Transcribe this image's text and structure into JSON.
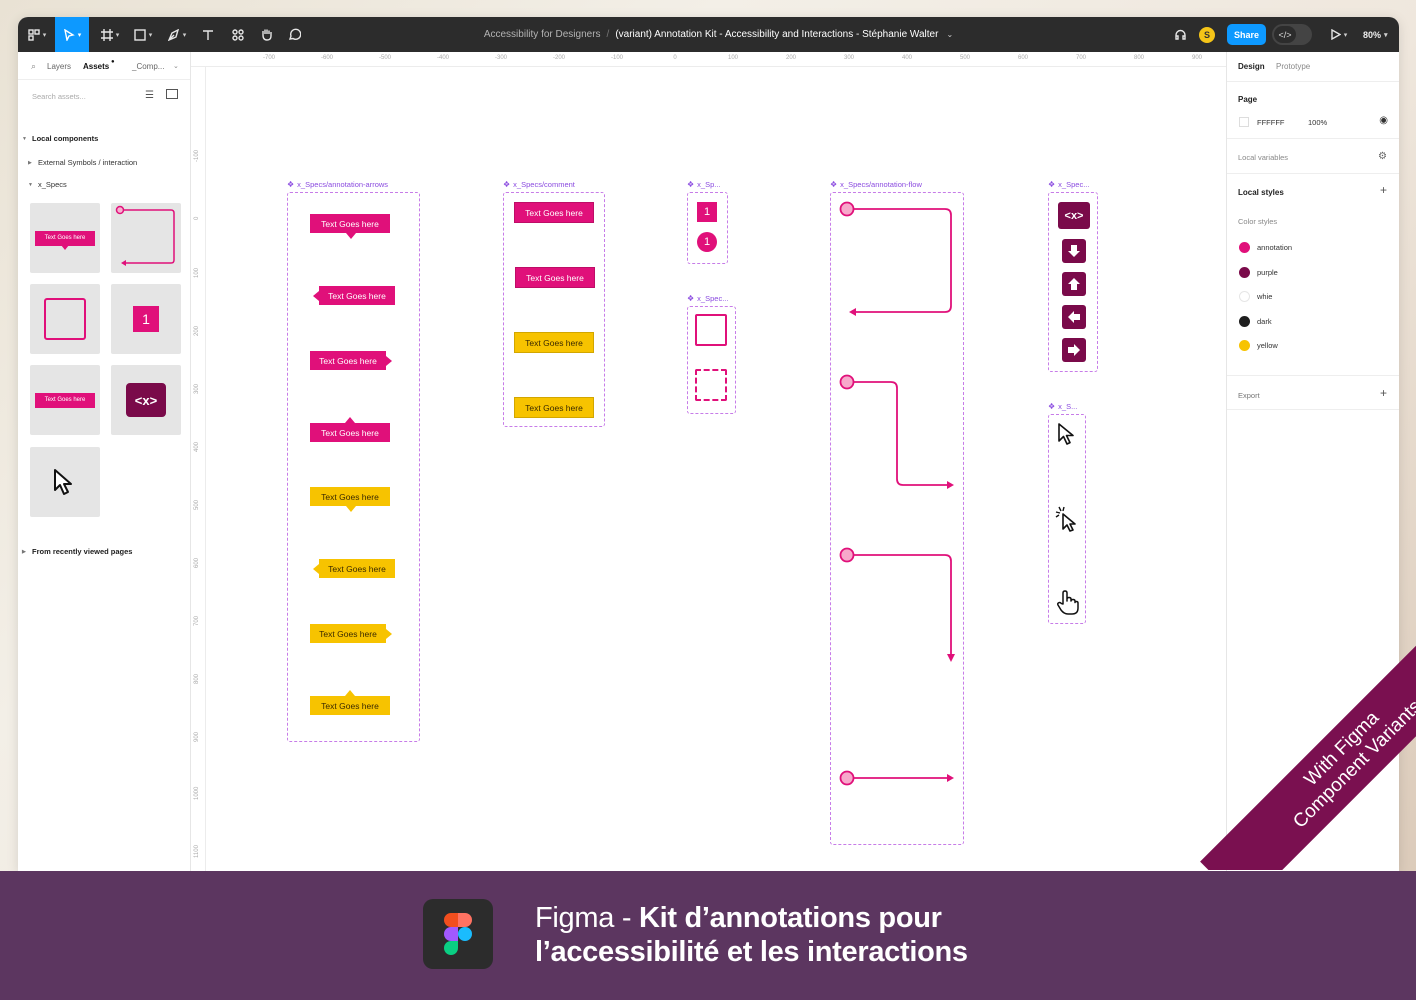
{
  "toolbar": {
    "project": "Accessibility for Designers",
    "separator": "/",
    "file": "(variant) Annotation Kit - Accessibility and Interactions - Stéphanie Walter",
    "avatar": "S",
    "share": "Share",
    "zoom": "80%",
    "icons": [
      "figma-menu-icon",
      "move-tool-icon",
      "frame-tool-icon",
      "shape-tool-icon",
      "pen-tool-icon",
      "text-tool-icon",
      "components-icon",
      "hand-tool-icon",
      "comment-icon",
      "headphones-icon",
      "dev-mode-icon",
      "present-icon"
    ]
  },
  "left_panel": {
    "tabs": [
      "Layers",
      "Assets",
      "_Comp..."
    ],
    "search_placeholder": "Search assets...",
    "local_components": "Local components",
    "external": "External Symbols / interaction",
    "specs": "x_Specs",
    "thumb_text_1": "Text Goes here",
    "thumb_text_2": "Text Goes here",
    "thumb_num": "1",
    "thumb_code": "<x>",
    "recent": "From recently viewed pages"
  },
  "ruler": {
    "top": [
      "-700",
      "-600",
      "-500",
      "-400",
      "-300",
      "-200",
      "-100",
      "0",
      "100",
      "200",
      "300",
      "400",
      "500",
      "600",
      "700",
      "800",
      "900"
    ],
    "left": [
      "-100",
      "0",
      "100",
      "200",
      "300",
      "400",
      "500",
      "600",
      "700",
      "800",
      "900",
      "1000",
      "1100"
    ]
  },
  "canvas": {
    "frames": {
      "arrows": "x_Specs/annotation-arrows",
      "comment": "x_Specs/comment",
      "sp": "x_Sp...",
      "spec_sq": "x_Spec...",
      "flow": "x_Specs/annotation-flow",
      "spec_btns": "x_Spec...",
      "s_cursor": "x_S..."
    },
    "tag_text": "Text Goes here",
    "number": "1",
    "code": "<x>"
  },
  "right_panel": {
    "tabs": [
      "Design",
      "Prototype"
    ],
    "page_label": "Page",
    "page_color": "FFFFFF",
    "page_opacity": "100%",
    "local_variables": "Local variables",
    "local_styles": "Local styles",
    "color_styles": "Color styles",
    "styles": [
      {
        "name": "annotation",
        "color": "#e0107a"
      },
      {
        "name": "purple",
        "color": "#7a0a4a"
      },
      {
        "name": "whie",
        "color": "#ffffff"
      },
      {
        "name": "dark",
        "color": "#1e1e1e"
      },
      {
        "name": "yellow",
        "color": "#f7c300"
      }
    ],
    "export": "Export"
  },
  "ribbon": {
    "line1": "With Figma",
    "line2": "Component Variants"
  },
  "footer": {
    "brand": "Figma",
    "dash": " - ",
    "title_bold_1": "Kit d’annotations pour",
    "title_bold_2": "l’accessibilité et les interactions"
  },
  "colors": {
    "annotation": "#e0107a",
    "purple": "#7a0a4a",
    "yellow": "#f7c300",
    "frame": "#c77ce8",
    "footer_bg": "#5c3660",
    "accent": "#0d99ff"
  }
}
